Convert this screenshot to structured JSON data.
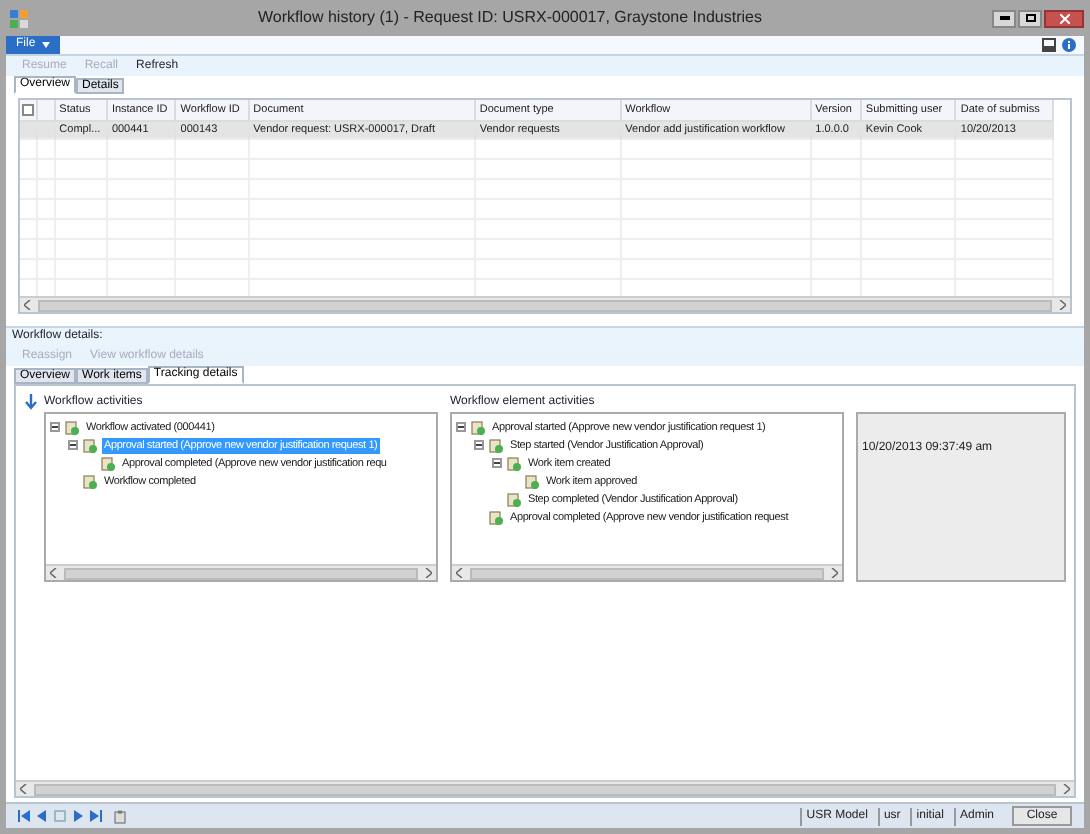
{
  "window": {
    "title": "Workflow history (1) - Request ID: USRX-000017, Graystone Industries"
  },
  "menu": {
    "file": "File"
  },
  "actions": [
    {
      "label": "Resume",
      "disabled": true
    },
    {
      "label": "Recall",
      "disabled": true
    },
    {
      "label": "Refresh",
      "disabled": false
    }
  ],
  "tabs": [
    {
      "label": "Overview",
      "selected": true
    },
    {
      "label": "Details",
      "selected": false
    }
  ],
  "table": {
    "select_all": {
      "checked": false
    },
    "columns": [
      "Status",
      "Instance ID",
      "Workflow ID",
      "Document",
      "Document type",
      "Workflow",
      "Version",
      "Submitting user",
      "Date of submiss"
    ],
    "rows": [
      {
        "selected": true,
        "cells": [
          "Compl...",
          "000441",
          "000143",
          "Vendor request: USRX-000017, Draft",
          "Vendor requests",
          "Vendor add justification workflow",
          "1.0.0.0",
          "Kevin Cook",
          "10/20/2013"
        ]
      }
    ]
  },
  "details": {
    "title": "Workflow details:",
    "actions": [
      {
        "label": "Reassign",
        "disabled": true
      },
      {
        "label": "View workflow details",
        "disabled": true
      }
    ],
    "tabs": [
      {
        "label": "Overview",
        "selected": false
      },
      {
        "label": "Work items",
        "selected": false
      },
      {
        "label": "Tracking details",
        "selected": true
      }
    ],
    "activities": {
      "title": "Workflow activities",
      "tree": [
        {
          "label": "Workflow activated (000441)",
          "expanded": true,
          "selected": false,
          "children": [
            {
              "label": "Approval started (Approve new vendor justification request 1)",
              "expanded": true,
              "selected": true,
              "children": [
                {
                  "label": "Approval completed (Approve new vendor justification requ",
                  "selected": false
                }
              ]
            },
            {
              "label": "Workflow completed",
              "selected": false
            }
          ]
        }
      ]
    },
    "element_activities": {
      "title": "Workflow element activities",
      "tree": [
        {
          "label": "Approval started (Approve new vendor justification request 1)",
          "expanded": true,
          "selected": false,
          "children": [
            {
              "label": "Step started (Vendor Justification Approval)",
              "expanded": true,
              "selected": false,
              "children": [
                {
                  "label": "Work item created",
                  "expanded": true,
                  "selected": false,
                  "children": [
                    {
                      "label": "Work item approved",
                      "selected": false
                    }
                  ]
                },
                {
                  "label": "Step completed (Vendor Justification Approval)",
                  "selected": false
                }
              ]
            },
            {
              "label": "Approval completed (Approve new vendor justification request",
              "selected": false
            }
          ]
        }
      ]
    },
    "timestamp": "10/20/2013 09:37:49 am"
  },
  "status_bar": {
    "items": [
      "USR Model",
      "usr",
      "initial",
      "Admin"
    ],
    "close": "Close"
  }
}
